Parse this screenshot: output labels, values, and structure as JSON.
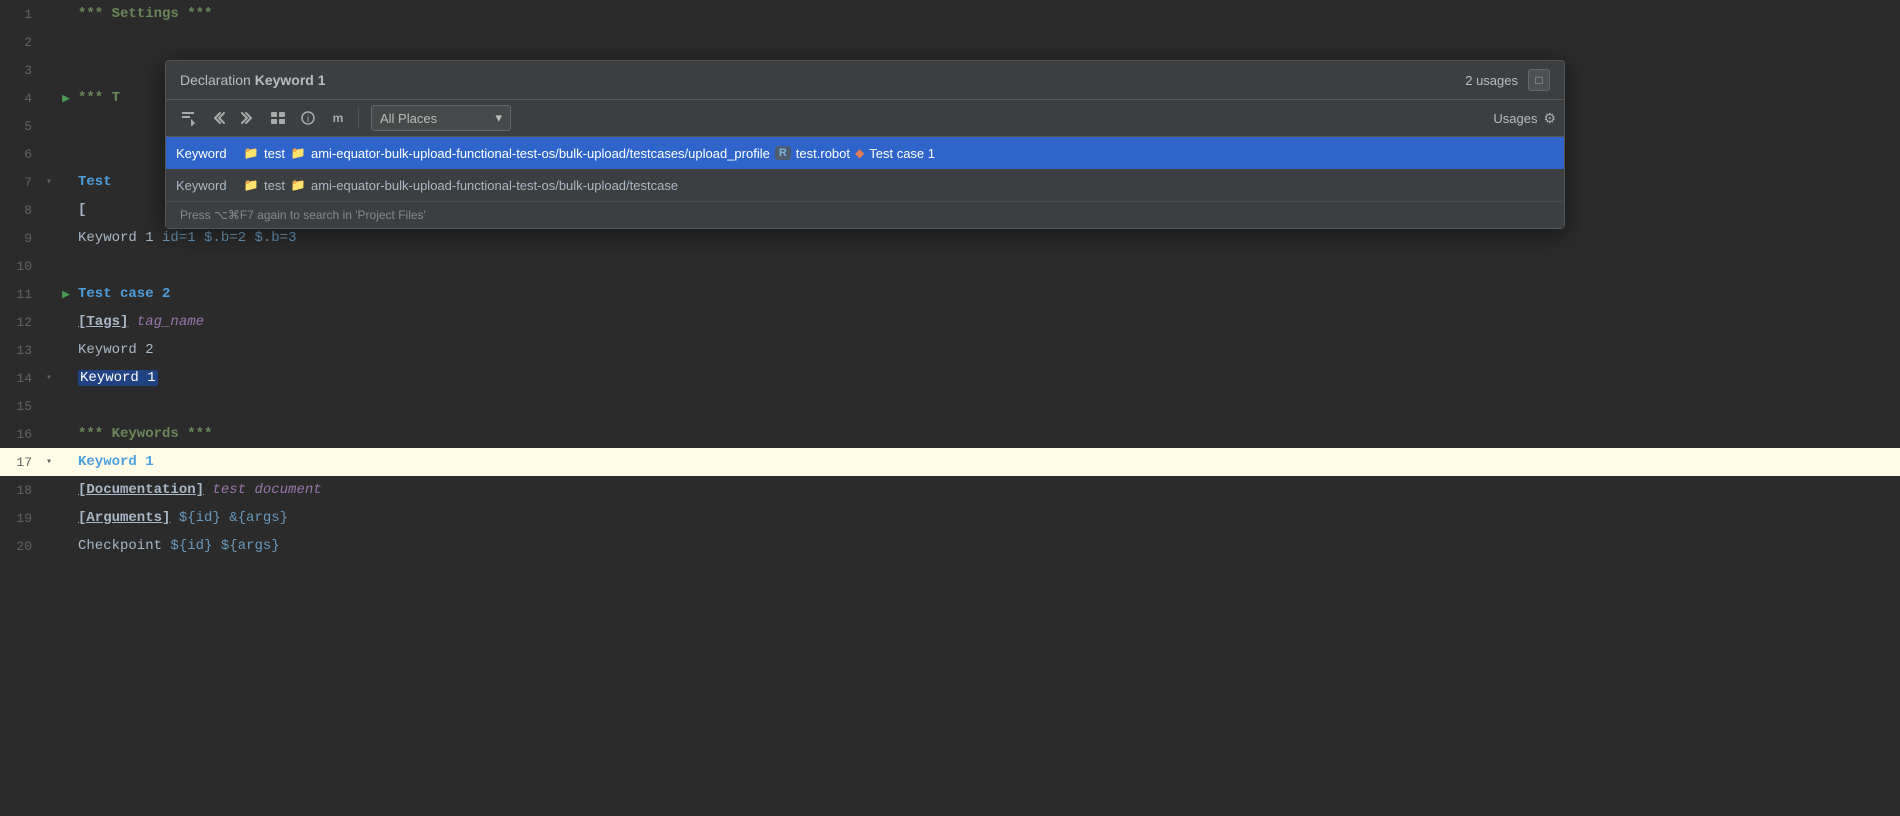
{
  "editor": {
    "background": "#2b2b2b",
    "lines": [
      {
        "num": 1,
        "fold": false,
        "arrow": false,
        "content_html": "<span class='kw-section'>*** Settings ***</span>"
      },
      {
        "num": 2,
        "fold": false,
        "arrow": false,
        "content_html": ""
      },
      {
        "num": 3,
        "fold": false,
        "arrow": false,
        "content_html": ""
      },
      {
        "num": 4,
        "fold": false,
        "arrow": true,
        "content_html": "<span class='kw-section'>*** T</span>"
      },
      {
        "num": 5,
        "fold": false,
        "arrow": false,
        "content_html": ""
      },
      {
        "num": 6,
        "fold": false,
        "arrow": false,
        "content_html": ""
      },
      {
        "num": 7,
        "fold": true,
        "arrow": false,
        "content_html": "<span class='kw-testname'>Test</span>"
      },
      {
        "num": 8,
        "fold": false,
        "arrow": false,
        "content_html": "    <span class='kw-bracket'>[</span>"
      },
      {
        "num": 9,
        "fold": false,
        "arrow": false,
        "content_html": "    <span class='kw-white'>Keyword 1</span>    <span class='kw-blue'>id=1</span>    <span class='kw-blue'>$.b=2</span>    <span class='kw-blue'>$.b=3</span>"
      },
      {
        "num": 10,
        "fold": false,
        "arrow": false,
        "content_html": ""
      },
      {
        "num": 11,
        "fold": false,
        "arrow": true,
        "content_html": "<span class='kw-testname'>Test case 2</span>"
      },
      {
        "num": 12,
        "fold": false,
        "arrow": false,
        "content_html": "    <span class='kw-tag'>[Tags]</span>    <span class='kw-italic-purple'>tag_name</span>"
      },
      {
        "num": 13,
        "fold": false,
        "arrow": false,
        "content_html": "    <span class='kw-white'>Keyword 2</span>"
      },
      {
        "num": 14,
        "fold": true,
        "arrow": false,
        "content_html": "    <span class='kw-highlight-box'>Keyword 1</span>"
      },
      {
        "num": 15,
        "fold": false,
        "arrow": false,
        "content_html": ""
      },
      {
        "num": 16,
        "fold": false,
        "arrow": false,
        "content_html": "<span class='kw-section'>*** Keywords ***</span>"
      },
      {
        "num": 17,
        "fold": true,
        "arrow": false,
        "content_html": "<span class='kw-testname'>Keyword 1</span>",
        "highlighted": true
      },
      {
        "num": 18,
        "fold": false,
        "arrow": false,
        "content_html": "    <span class='kw-tag'>[Documentation]</span>    <span class='kw-italic-purple'>test document</span>"
      },
      {
        "num": 19,
        "fold": false,
        "arrow": false,
        "content_html": "    <span class='kw-tag'>[Arguments]</span>    <span class='kw-dollar'>${id}</span>    <span class='kw-dollar'>&amp;{args}</span>"
      },
      {
        "num": 20,
        "fold": false,
        "arrow": false,
        "content_html": "    <span class='kw-white'>Checkpoint</span>    <span class='kw-dollar'>${id}</span>    <span class='kw-dollar'>${args}</span>"
      }
    ]
  },
  "popup": {
    "title_prefix": "Declaration ",
    "title_keyword": "Keyword 1",
    "usages_count": "2 usages",
    "pin_label": "□",
    "toolbar": {
      "btn1": "⬇",
      "btn2": "↺",
      "btn3": "↻",
      "btn4": "📁",
      "btn5": "ℹ",
      "btn6": "m",
      "dropdown_label": "All Places",
      "usages_label": "Usages",
      "gear_label": "⚙"
    },
    "results": [
      {
        "selected": true,
        "label": "Keyword",
        "folder_color": "yellow",
        "folder_name": "test",
        "path_color": "blue",
        "path": "ami-equator-bulk-upload-functional-test-os/bulk-upload/testcases/upload_profile",
        "badge": "R",
        "robot_file": "test.robot",
        "arrow": "◆",
        "test_label": "Test case 1"
      },
      {
        "selected": false,
        "label": "Keyword",
        "folder_color": "yellow",
        "folder_name": "test",
        "path_color": "blue",
        "path": "ami-equator-bulk-upload-functional-test-os/bulk-upload/testcase",
        "badge": "",
        "robot_file": "",
        "arrow": "",
        "test_label": ""
      }
    ],
    "hint": "Press ⌥⌘F7 again to search in 'Project Files'"
  }
}
